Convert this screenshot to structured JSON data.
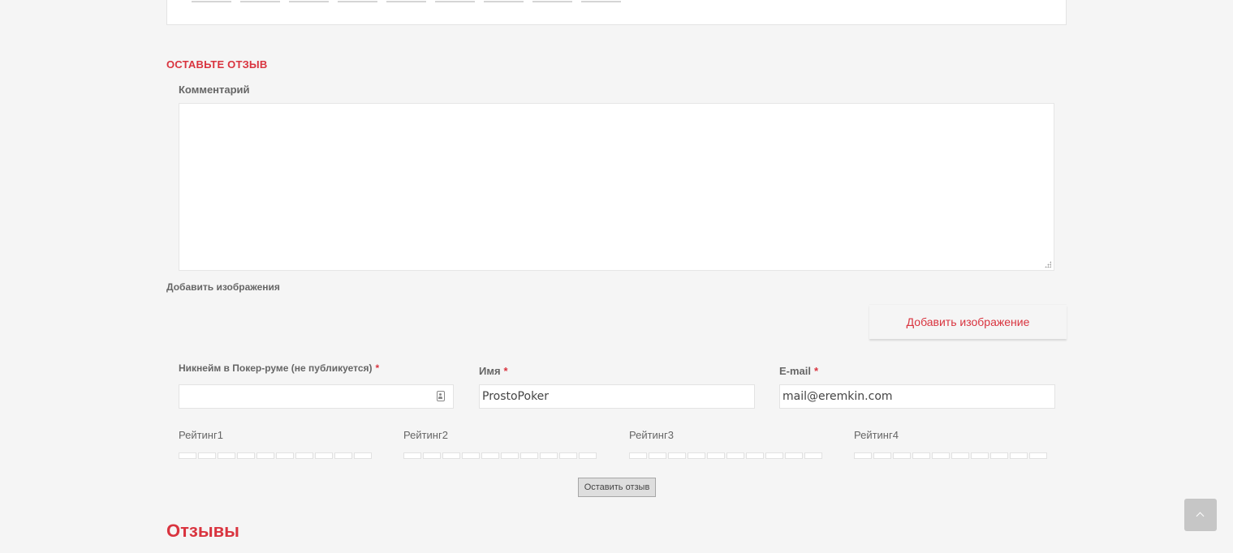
{
  "form": {
    "heading": "ОСТАВЬТЕ ОТЗЫВ",
    "comment_label": "Комментарий",
    "add_images_label": "Добавить изображения",
    "add_image_button": "Добавить изображение",
    "nickname_label": "Никнейм в Покер-руме (не публикуется)",
    "name_label": "Имя",
    "email_label": "E-mail",
    "required_mark": "*",
    "name_value": "ProstoPoker",
    "email_value": "mail@eremkin.com",
    "ratings": [
      "Рейтинг1",
      "Рейтинг2",
      "Рейтинг3",
      "Рейтинг4"
    ],
    "submit_button": "Оставить отзыв"
  },
  "reviews": {
    "heading": "Отзывы"
  },
  "colors": {
    "accent": "#d9343f",
    "background": "#f5f5f5"
  },
  "icons": {
    "nickname_field": "contact-card-icon",
    "scroll_top": "chevron-up-icon"
  }
}
